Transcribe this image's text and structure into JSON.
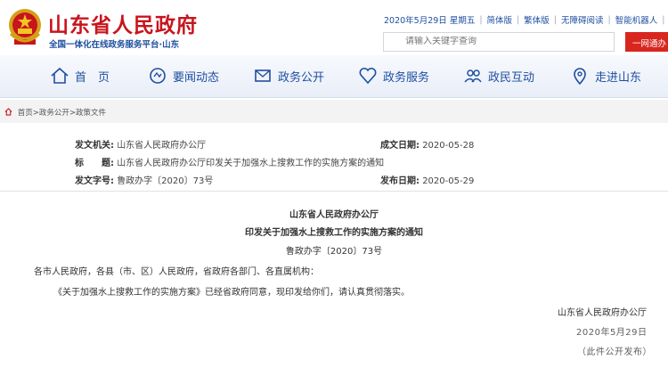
{
  "header": {
    "site_title": "山东省人民政府",
    "site_subtitle": "全国一体化在线政务服务平台·山东",
    "date": "2020年5月29日 星期五",
    "lang_simplified": "简体版",
    "lang_traditional": "繁体版",
    "accessibility": "无障碍阅读",
    "robot": "智能机器人",
    "search_placeholder": "请输入关键字查询",
    "red_button": "一网通办"
  },
  "nav": {
    "items": [
      {
        "label": "首　页",
        "icon": "home-icon"
      },
      {
        "label": "要闻动态",
        "icon": "news-icon"
      },
      {
        "label": "政务公开",
        "icon": "envelope-icon"
      },
      {
        "label": "政务服务",
        "icon": "heart-icon"
      },
      {
        "label": "政民互动",
        "icon": "people-icon"
      },
      {
        "label": "走进山东",
        "icon": "location-icon"
      }
    ]
  },
  "breadcrumb": {
    "home": "首页",
    "level1": "政务公开",
    "level2": "政策文件",
    "separator": ">"
  },
  "meta": {
    "issuer_label": "发文机关:",
    "issuer_value": "山东省人民政府办公厅",
    "date_label": "成文日期:",
    "date_value": "2020-05-28",
    "title_label": "标　　题:",
    "title_value": "山东省人民政府办公厅印发关于加强水上搜救工作的实施方案的通知",
    "docno_label": "发文字号:",
    "docno_value": "鲁政办字〔2020〕73号",
    "pubdate_label": "发布日期:",
    "pubdate_value": "2020-05-29"
  },
  "document": {
    "org": "山东省人民政府办公厅",
    "heading": "印发关于加强水上搜救工作的实施方案的通知",
    "number": "鲁政办字〔2020〕73号",
    "salutation": "各市人民政府，各县（市、区）人民政府，省政府各部门、各直属机构：",
    "body": "《关于加强水上搜救工作的实施方案》已经省政府同意，现印发给你们，请认真贯彻落实。",
    "signature": "山东省人民政府办公厅",
    "sign_date": "2020年5月29日",
    "note": "（此件公开发布）"
  },
  "colors": {
    "brand_red": "#c8151d",
    "nav_blue": "#1f4fa0",
    "button_red": "#d8261f"
  }
}
